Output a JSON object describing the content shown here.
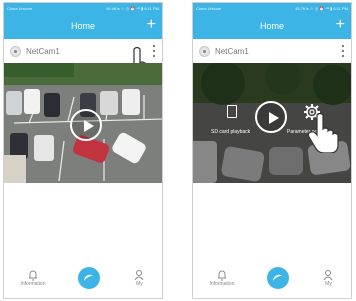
{
  "left": {
    "status": {
      "carrier": "China Unicom",
      "right": "99.4K/s  ☆ ◷ ⏰ ⁴ᴳ ▮ 6:11 PM"
    },
    "title": "Home",
    "plus": "+",
    "camera_name": "NetCam1",
    "tabs": [
      {
        "label": "Information",
        "icon": "bell-icon"
      },
      {
        "label": "",
        "icon": "center-icon"
      },
      {
        "label": "My",
        "icon": "person-icon"
      }
    ]
  },
  "right": {
    "status": {
      "carrier": "China Unicom",
      "right": "45.7K/s  ☆ ◷ ⏰ ⁴ᴳ ▮ 6:11 PM"
    },
    "title": "Home",
    "plus": "+",
    "camera_name": "NetCam1",
    "overlay": {
      "sd_label": "SD card playback",
      "settings_label": "Parameter settings"
    },
    "tabs": [
      {
        "label": "Information",
        "icon": "bell-icon"
      },
      {
        "label": "",
        "icon": "center-icon"
      },
      {
        "label": "My",
        "icon": "person-icon"
      }
    ]
  },
  "colors": {
    "accent": "#3db4e6"
  }
}
